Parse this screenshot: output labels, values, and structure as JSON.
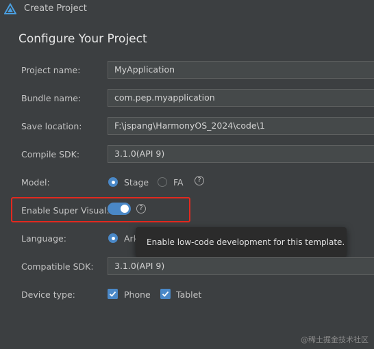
{
  "window": {
    "title": "Create Project"
  },
  "page": {
    "heading": "Configure Your Project"
  },
  "fields": {
    "project_name": {
      "label": "Project name:",
      "value": "MyApplication"
    },
    "bundle_name": {
      "label": "Bundle name:",
      "value": "com.pep.myapplication"
    },
    "save_location": {
      "label": "Save location:",
      "value": "F:\\jspang\\HarmonyOS_2024\\code\\1"
    },
    "compile_sdk": {
      "label": "Compile SDK:",
      "value": "3.1.0(API 9)"
    },
    "model": {
      "label": "Model:",
      "options": [
        "Stage",
        "FA"
      ],
      "selected": "Stage",
      "help": "?"
    },
    "super_visual": {
      "label": "Enable Super Visual:",
      "enabled": true,
      "help": "?"
    },
    "language": {
      "label": "Language:",
      "value": "Ark"
    },
    "compatible_sdk": {
      "label": "Compatible SDK:",
      "value": "3.1.0(API 9)"
    },
    "device_type": {
      "label": "Device type:",
      "options": [
        "Phone",
        "Tablet"
      ],
      "checked": [
        "Phone",
        "Tablet"
      ]
    }
  },
  "tooltip": {
    "text": "Enable low-code development for this template."
  },
  "watermark": {
    "text": "@稀土掘金技术社区"
  },
  "colors": {
    "accent": "#4a88c7",
    "highlight": "#e2291f",
    "background": "#3c3f41"
  }
}
